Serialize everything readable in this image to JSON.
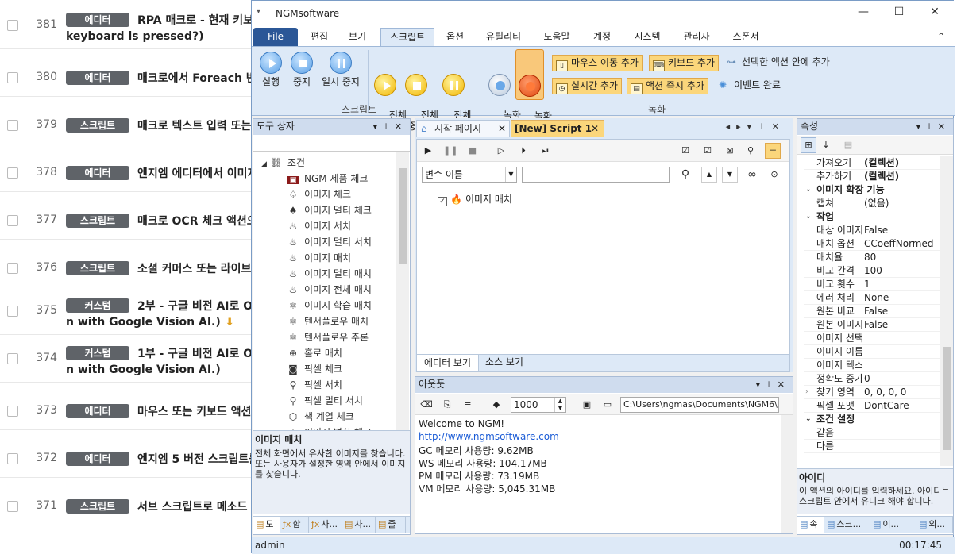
{
  "bg_list": [
    {
      "num": "381",
      "badge": "에디터",
      "title": "RPA 매크로 - 현재 키보드",
      "title2": "keyboard is pressed?)",
      "dl": false
    },
    {
      "num": "380",
      "badge": "에디터",
      "title": "매크로에서 Foreach 반복",
      "title2": "",
      "dl": false
    },
    {
      "num": "379",
      "badge": "스크립트",
      "title": "매크로 텍스트 입력 또는 스",
      "title2": "",
      "dl": false
    },
    {
      "num": "378",
      "badge": "에디터",
      "title": "엔지엠 에디터에서 이미지",
      "title2": "",
      "dl": false
    },
    {
      "num": "377",
      "badge": "스크립트",
      "title": "매크로 OCR 체크 액션으로",
      "title2": "",
      "dl": false
    },
    {
      "num": "376",
      "badge": "스크립트",
      "title": "소셜 커머스 또는 라이브 커",
      "title2": "",
      "dl": false
    },
    {
      "num": "375",
      "badge": "커스텀",
      "title": "2부 - 구글 비전 AI로 OCR",
      "title2": "n with Google Vision AI.)",
      "dl": true
    },
    {
      "num": "374",
      "badge": "커스텀",
      "title": "1부 - 구글 비전 AI로 OCR",
      "title2": "n with Google Vision AI.)",
      "dl": false
    },
    {
      "num": "373",
      "badge": "에디터",
      "title": "마우스 또는 키보드 액션이",
      "title2": "",
      "dl": false
    },
    {
      "num": "372",
      "badge": "에디터",
      "title": "엔지엠 5 버전 스크립트를",
      "title2": "",
      "dl": false
    },
    {
      "num": "371",
      "badge": "스크립트",
      "title": "서브 스크립트로 메소드 또",
      "title2": "",
      "dl": false
    }
  ],
  "window": {
    "title": "NGMsoftware",
    "system_menu": "▾",
    "min": "—",
    "max": "☐",
    "close": "✕"
  },
  "ribbon_tabs": [
    "File",
    "편집",
    "보기",
    "스크립트",
    "옵션",
    "유틸리티",
    "도움말",
    "계정",
    "시스템",
    "관리자",
    "스폰서"
  ],
  "ribbon_collapse": "⌃",
  "ribbon": {
    "run": "실행",
    "stop": "중지",
    "pause": "일시 중지",
    "all_run": "전체\n실행",
    "all_stop": "전체\n중지",
    "all_pause": "전체\n일시 중지",
    "group_script": "스크립트",
    "rec_start": "녹화\n시작",
    "rec_stop": "녹화\n중지",
    "mouse_add": "마우스 이동 추가",
    "kbd_add": "키보드 추가",
    "add_in_selected": "선택한 액션 안에 추가",
    "realtime_add": "실시간 추가",
    "instant_add": "액션 즉시 추가",
    "event_done": "이벤트 완료",
    "group_rec": "녹화"
  },
  "toolbox": {
    "title": "도구 상자",
    "category": "조건",
    "items": [
      {
        "icon": "ngm-icon",
        "label": "NGM 제품 체크"
      },
      {
        "icon": "image-check-icon",
        "label": "이미지 체크"
      },
      {
        "icon": "image-multi-check-icon",
        "label": "이미지 멀티 체크"
      },
      {
        "icon": "image-search-icon",
        "label": "이미지 서치"
      },
      {
        "icon": "image-multi-search-icon",
        "label": "이미지 멀티 서치"
      },
      {
        "icon": "image-match-icon",
        "label": "이미지 매치"
      },
      {
        "icon": "image-multi-match-icon",
        "label": "이미지 멀티 매치"
      },
      {
        "icon": "image-all-match-icon",
        "label": "이미지 전체 매치"
      },
      {
        "icon": "image-learn-match-icon",
        "label": "이미지 학습 매치"
      },
      {
        "icon": "tensorflow-match-icon",
        "label": "텐서플로우 매치"
      },
      {
        "icon": "tensorflow-infer-icon",
        "label": "텐서플로우 추론"
      },
      {
        "icon": "hole-match-icon",
        "label": "홀로 매치"
      },
      {
        "icon": "pixel-check-icon",
        "label": "픽셀 체크"
      },
      {
        "icon": "pixel-search-icon",
        "label": "픽셀 서치"
      },
      {
        "icon": "pixel-multi-search-icon",
        "label": "픽셀 멀티 서치"
      },
      {
        "icon": "color-check-icon",
        "label": "색 계열 체크"
      },
      {
        "icon": "image-change-icon",
        "label": "이미지 변화 체크"
      }
    ],
    "desc_title": "이미지 매치",
    "desc_text": "전체 화면에서 유사한 이미지를 찾습니다. 또는 사용자가 설정한 영역 안에서 이미지를 찾습니다.",
    "tabs": [
      "도",
      "함",
      "사...",
      "사...",
      "줄"
    ]
  },
  "editor": {
    "tab_start": "시작 페이지",
    "tab_script": "[New] Script 1",
    "var_placeholder": "변수 이름",
    "node_label": "이미지 매치",
    "view_editor": "에디터 보기",
    "view_source": "소스 보기"
  },
  "output": {
    "title": "아웃풋",
    "count": "1000",
    "path": "C:\\Users\\ngmas\\Documents\\NGM6\\",
    "lines": [
      "Welcome to NGM!",
      "http://www.ngmsoftware.com",
      "GC 메모리 사용량: 9.62MB",
      "WS 메모리 사용량: 104.17MB",
      "PM 메모리 사용량: 73.19MB",
      "VM 메모리 사용량: 5,045.31MB"
    ]
  },
  "props": {
    "title": "속성",
    "rows": [
      {
        "type": "kv",
        "k": "가져오기",
        "v": "(컬렉션)",
        "bold": true
      },
      {
        "type": "kv",
        "k": "추가하기",
        "v": "(컬렉션)",
        "bold": true
      },
      {
        "type": "cat",
        "k": "이미지 확장 기능"
      },
      {
        "type": "kv",
        "k": "캡쳐",
        "v": "(없음)"
      },
      {
        "type": "cat",
        "k": "작업"
      },
      {
        "type": "kv",
        "k": "대상 이미지",
        "v": "False"
      },
      {
        "type": "kv",
        "k": "매치 옵션",
        "v": "CCoeffNormed"
      },
      {
        "type": "kv",
        "k": "매치율",
        "v": "80"
      },
      {
        "type": "kv",
        "k": "비교 간격",
        "v": "100"
      },
      {
        "type": "kv",
        "k": "비교 횟수",
        "v": "1"
      },
      {
        "type": "kv",
        "k": "에러 처리",
        "v": "None"
      },
      {
        "type": "kv",
        "k": "원본 비교",
        "v": "False"
      },
      {
        "type": "kv",
        "k": "원본 이미지",
        "v": "False"
      },
      {
        "type": "kv",
        "k": "이미지 선택",
        "v": ""
      },
      {
        "type": "kv",
        "k": "이미지 이름",
        "v": ""
      },
      {
        "type": "kv",
        "k": "이미지 텍스트",
        "v": ""
      },
      {
        "type": "kv",
        "k": "정확도 증가",
        "v": "0"
      },
      {
        "type": "kv",
        "k": "찾기 영역",
        "v": "0, 0, 0, 0",
        "exp": true
      },
      {
        "type": "kv",
        "k": "픽셀 포맷",
        "v": "DontCare"
      },
      {
        "type": "cat",
        "k": "조건 설정"
      },
      {
        "type": "kv",
        "k": "같음",
        "v": ""
      },
      {
        "type": "kv",
        "k": "다름",
        "v": ""
      }
    ],
    "desc_title": "아이디",
    "desc_text": "이 액션의 아이디를 입력하세요. 아이디는 스크립트 안에서 유니크 해야 합니다.",
    "tabs": [
      "속",
      "스크...",
      "이...",
      "외..."
    ]
  },
  "status": {
    "user": "admin",
    "time": "00:17:45"
  }
}
